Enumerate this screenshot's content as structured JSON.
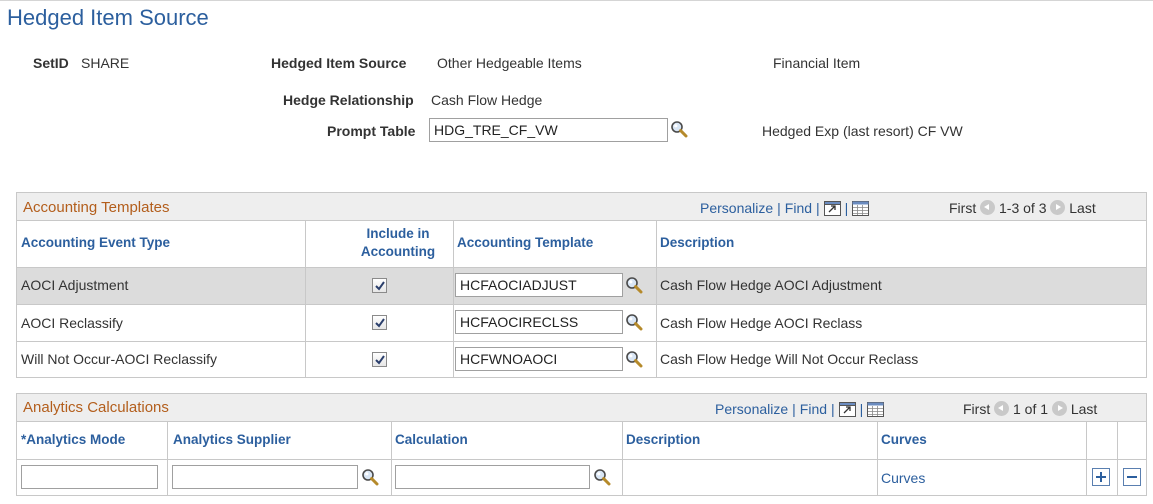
{
  "page": {
    "title": "Hedged Item Source"
  },
  "header_fields": {
    "setid_label": "SetID",
    "setid_value": "SHARE",
    "hedged_item_source_label": "Hedged Item Source",
    "hedged_item_source_value": "Other Hedgeable Items",
    "financial_item_text": "Financial Item",
    "hedge_relationship_label": "Hedge Relationship",
    "hedge_relationship_value": "Cash Flow Hedge",
    "prompt_table_label": "Prompt Table",
    "prompt_table_value": "HDG_TRE_CF_VW",
    "prompt_table_description": "Hedged Exp (last resort) CF VW"
  },
  "accounting_grid": {
    "title": "Accounting Templates",
    "personalize": "Personalize",
    "find": "Find",
    "first": "First",
    "range": "1-3 of 3",
    "last": "Last",
    "columns": {
      "event_type": "Accounting Event Type",
      "include_line1": "Include in",
      "include_line2": "Accounting",
      "template": "Accounting Template",
      "description": "Description"
    },
    "rows": [
      {
        "event_type": "AOCI Adjustment",
        "include": true,
        "template": "HCFAOCIADJUST",
        "description": "Cash Flow Hedge AOCI Adjustment"
      },
      {
        "event_type": "AOCI Reclassify",
        "include": true,
        "template": "HCFAOCIRECLSS",
        "description": "Cash Flow Hedge AOCI Reclass"
      },
      {
        "event_type": "Will Not Occur-AOCI Reclassify",
        "include": true,
        "template": "HCFWNOAOCI",
        "description": "Cash Flow Hedge Will Not Occur Reclass"
      }
    ]
  },
  "analytics_grid": {
    "title": "Analytics Calculations",
    "personalize": "Personalize",
    "find": "Find",
    "first": "First",
    "range": "1 of 1",
    "last": "Last",
    "columns": {
      "mode": "*Analytics Mode",
      "supplier": "Analytics Supplier",
      "calculation": "Calculation",
      "description": "Description",
      "curves": "Curves"
    },
    "rows": [
      {
        "mode": "",
        "supplier": "",
        "calculation": "",
        "description": "",
        "curves_link": "Curves"
      }
    ]
  },
  "colors": {
    "title_blue": "#2c5f9e",
    "grid_title_orange": "#b35e1c",
    "grid_header_bg": "#eeeeee",
    "alt_row_bg": "#dcdcdc"
  },
  "icons": {
    "lookup": "magnifier-icon",
    "zoom": "new-window-icon",
    "download": "spreadsheet-icon",
    "prev": "circle-left-arrow-icon",
    "next": "circle-right-arrow-icon",
    "add_row": "plus-icon",
    "delete_row": "minus-icon",
    "checkbox": "checkmark-icon"
  }
}
